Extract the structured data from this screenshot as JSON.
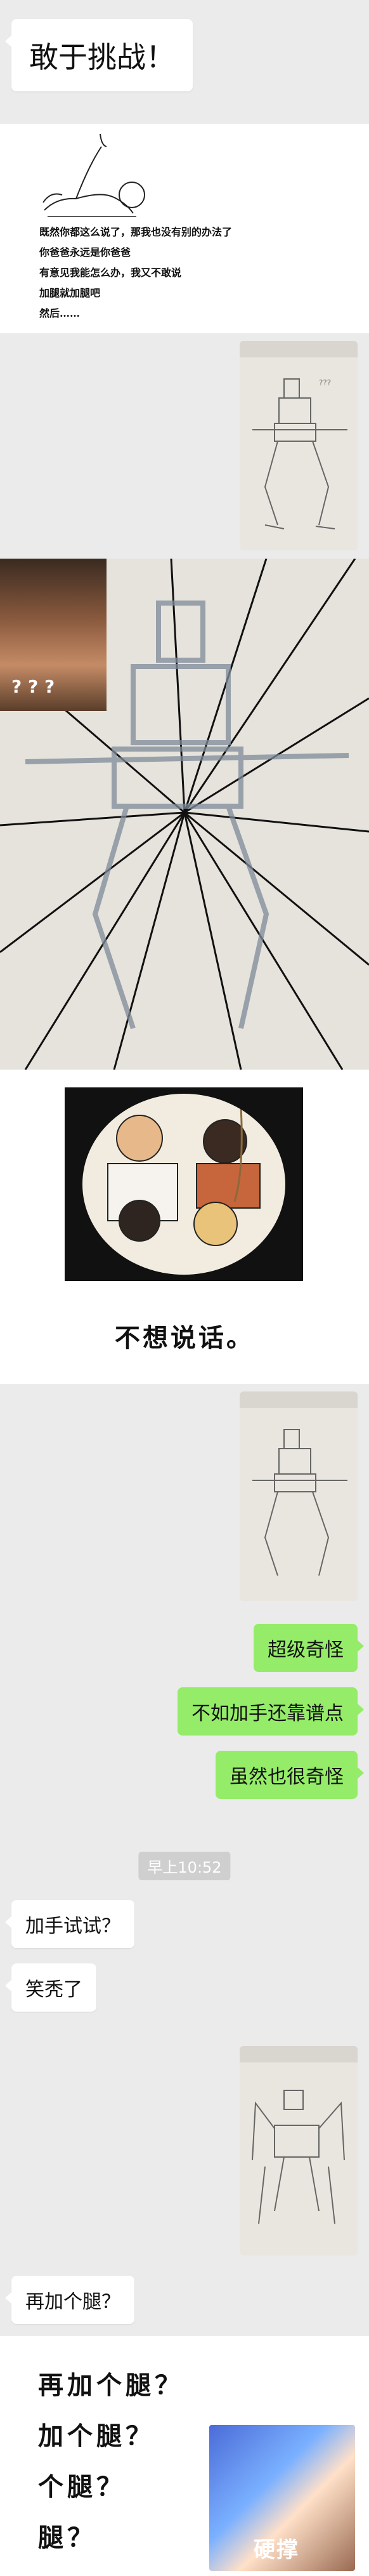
{
  "title_message": "敢于挑战！",
  "meme_text": {
    "lines": [
      "既然你都这么说了，那我也没有别的办法了",
      "你爸爸永远是你爸爸",
      "有意见我能怎么办，我又不敢说",
      "加腿就加腿吧",
      "然后……"
    ]
  },
  "reaction_overlay": "? ? ?",
  "comic_caption": "不想说话。",
  "chat": {
    "messages_right": [
      "超级奇怪",
      "不如加手还靠谱点",
      "虽然也很奇怪"
    ],
    "timestamp": "早上10:52",
    "messages_left": [
      "加手试试？",
      "笑秃了"
    ],
    "last_message": "再加个腿？"
  },
  "final_lines": [
    "再加个腿？",
    "加个腿？",
    "个腿？",
    "腿？"
  ],
  "final_stamp": "硬撑",
  "photo_overlay_note": "???",
  "colors": {
    "bg": "#ebebeb",
    "green_bubble": "#95ec69",
    "white_bubble": "#ffffff"
  }
}
